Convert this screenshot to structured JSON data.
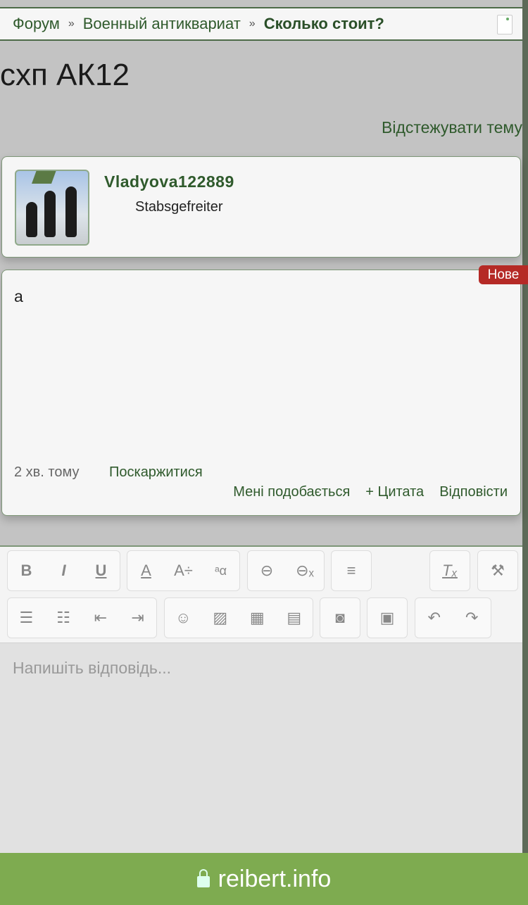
{
  "breadcrumb": {
    "items": [
      "Форум",
      "Военный антиквариат"
    ],
    "current": "Сколько стоит?",
    "separator": "»"
  },
  "thread": {
    "title": "схп АК12",
    "follow_label": "Відстежувати тему"
  },
  "post": {
    "author": "Vladyova122889",
    "rank": "Stabsgefreiter",
    "badge": "Нове",
    "body": "а",
    "time": "2 хв. тому",
    "report_label": "Поскаржитися",
    "like_label": "Мені подобається",
    "quote_label": "+ Цитата",
    "reply_label": "Відповісти"
  },
  "editor": {
    "placeholder": "Напишіть відповідь..."
  },
  "browser": {
    "domain": "reibert.info"
  }
}
